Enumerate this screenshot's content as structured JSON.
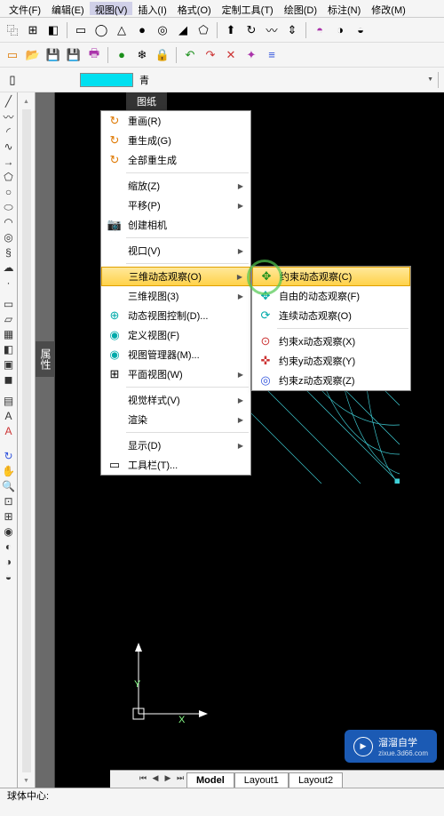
{
  "menubar": [
    "文件(F)",
    "编辑(E)",
    "视图(V)",
    "插入(I)",
    "格式(O)",
    "定制工具(T)",
    "绘图(D)",
    "标注(N)",
    "修改(M)"
  ],
  "active_menu_index": 2,
  "color_row": {
    "swatch": "#00e0f0",
    "label": "青"
  },
  "tab_label": "图纸",
  "side_tab": "属性",
  "menu_main": [
    {
      "icon": "↻",
      "label": "重画(R)",
      "color": "orange"
    },
    {
      "icon": "↻",
      "label": "重生成(G)",
      "color": "orange"
    },
    {
      "icon": "↻",
      "label": "全部重生成",
      "color": "orange"
    },
    {
      "sep": true
    },
    {
      "icon": "",
      "label": "缩放(Z)",
      "sub": true
    },
    {
      "icon": "",
      "label": "平移(P)",
      "sub": true
    },
    {
      "icon": "📷",
      "label": "创建相机"
    },
    {
      "sep": true
    },
    {
      "icon": "",
      "label": "视口(V)",
      "sub": true
    },
    {
      "sep": true
    },
    {
      "icon": "",
      "label": "三维动态观察(O)",
      "sub": true,
      "hl": true
    },
    {
      "icon": "",
      "label": "三维视图(3)",
      "sub": true
    },
    {
      "icon": "⊕",
      "label": "动态视图控制(D)...",
      "color": "teal"
    },
    {
      "icon": "◉",
      "label": "定义视图(F)",
      "color": "teal"
    },
    {
      "icon": "◉",
      "label": "视图管理器(M)...",
      "color": "teal"
    },
    {
      "icon": "⊞",
      "label": "平面视图(W)",
      "sub": true
    },
    {
      "sep": true
    },
    {
      "icon": "",
      "label": "视觉样式(V)",
      "sub": true
    },
    {
      "icon": "",
      "label": "渲染",
      "sub": true
    },
    {
      "sep": true
    },
    {
      "icon": "",
      "label": "显示(D)",
      "sub": true
    },
    {
      "icon": "▭",
      "label": "工具栏(T)..."
    }
  ],
  "menu_sub": [
    {
      "icon": "✥",
      "label": "约束动态观察(C)",
      "color": "green",
      "hl": true
    },
    {
      "icon": "✥",
      "label": "自由的动态观察(F)",
      "color": "teal"
    },
    {
      "icon": "⟳",
      "label": "连续动态观察(O)",
      "color": "teal"
    },
    {
      "sep": true
    },
    {
      "icon": "⊙",
      "label": "约束x动态观察(X)",
      "color": "red"
    },
    {
      "icon": "✜",
      "label": "约束y动态观察(Y)",
      "color": "red"
    },
    {
      "icon": "◎",
      "label": "约束z动态观察(Z)",
      "color": "blue"
    }
  ],
  "axis": {
    "x": "X",
    "y": "Y"
  },
  "bottom_tabs": [
    "Model",
    "Layout1",
    "Layout2"
  ],
  "status_line1": "球体中心:",
  "status_line2": "",
  "watermark": {
    "text": "溜溜自学",
    "url": "zixue.3d66.com"
  }
}
